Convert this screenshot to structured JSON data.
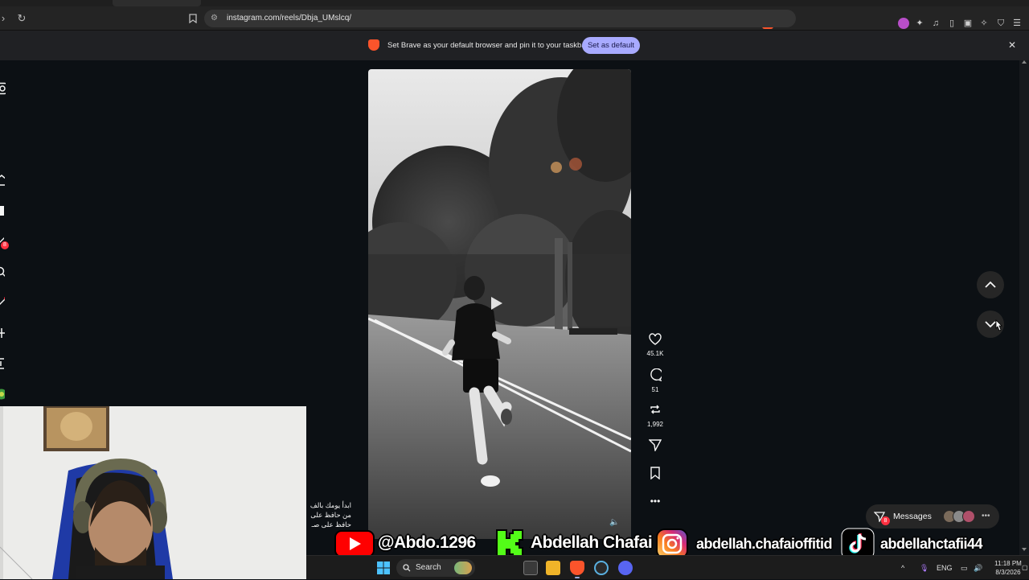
{
  "browser": {
    "url": "instagram.com/reels/Dbja_UMslcq/",
    "notification": {
      "text": "Set Brave as your default browser and pin it to your taskbar",
      "button_label": "Set as default"
    }
  },
  "reel": {
    "actions": [
      {
        "name": "like",
        "icon": "heart-icon",
        "count": "45.1K"
      },
      {
        "name": "comment",
        "icon": "comment-icon",
        "count": "51"
      },
      {
        "name": "repost",
        "icon": "repost-icon",
        "count": "1,992"
      },
      {
        "name": "share",
        "icon": "send-icon",
        "count": ""
      },
      {
        "name": "save",
        "icon": "bookmark-icon",
        "count": ""
      },
      {
        "name": "more",
        "icon": "more-icon",
        "count": ""
      }
    ],
    "caption_lines": [
      "ابدأ يومك بالف",
      "من حافظ على",
      "حافظ على صـ"
    ]
  },
  "sidebar": {
    "notifications_badge": "8"
  },
  "messages": {
    "label": "Messages",
    "badge": "8"
  },
  "overlay": {
    "youtube_handle": "@Abdo.1296",
    "kick_name": "Abdellah Chafai",
    "instagram_handle": "abdellah.chafaioffitid",
    "tiktok_handle": "abdellahctafii44"
  },
  "taskbar": {
    "search_label": "Search",
    "language": "ENG",
    "time": "11:18 PM",
    "date": "8/3/2026"
  },
  "colors": {
    "page_bg": "#0c1014",
    "notif_button": "#a8aaff",
    "badge_red": "#ff3040",
    "brave_orange": "#fb542b"
  }
}
